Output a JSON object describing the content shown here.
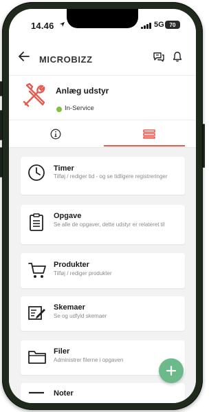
{
  "status_bar": {
    "time": "14.46",
    "network": "5G",
    "battery": "70"
  },
  "header": {
    "title": "MICROBIZZ"
  },
  "equipment": {
    "name": "Anlæg udstyr",
    "status": "In-Service"
  },
  "colors": {
    "accent": "#e85a50",
    "status_green": "#7ec242",
    "fab": "#6cba8a"
  },
  "menu": [
    {
      "title": "Timer",
      "subtitle": "Tilføj / rediger tid - og se tidligere registreringer",
      "icon": "clock-icon"
    },
    {
      "title": "Opgave",
      "subtitle": "Se alle de opgaver, dette udstyr er relateret til",
      "icon": "clipboard-icon"
    },
    {
      "title": "Produkter",
      "subtitle": "Tilføj / rediger produkter",
      "icon": "cart-icon"
    },
    {
      "title": "Skemaer",
      "subtitle": "Se og udfyld skemaer",
      "icon": "form-edit-icon"
    },
    {
      "title": "Filer",
      "subtitle": "Administrer filerne i opgaven",
      "icon": "folder-icon"
    },
    {
      "title": "Noter",
      "subtitle": "",
      "icon": "notes-icon"
    }
  ]
}
